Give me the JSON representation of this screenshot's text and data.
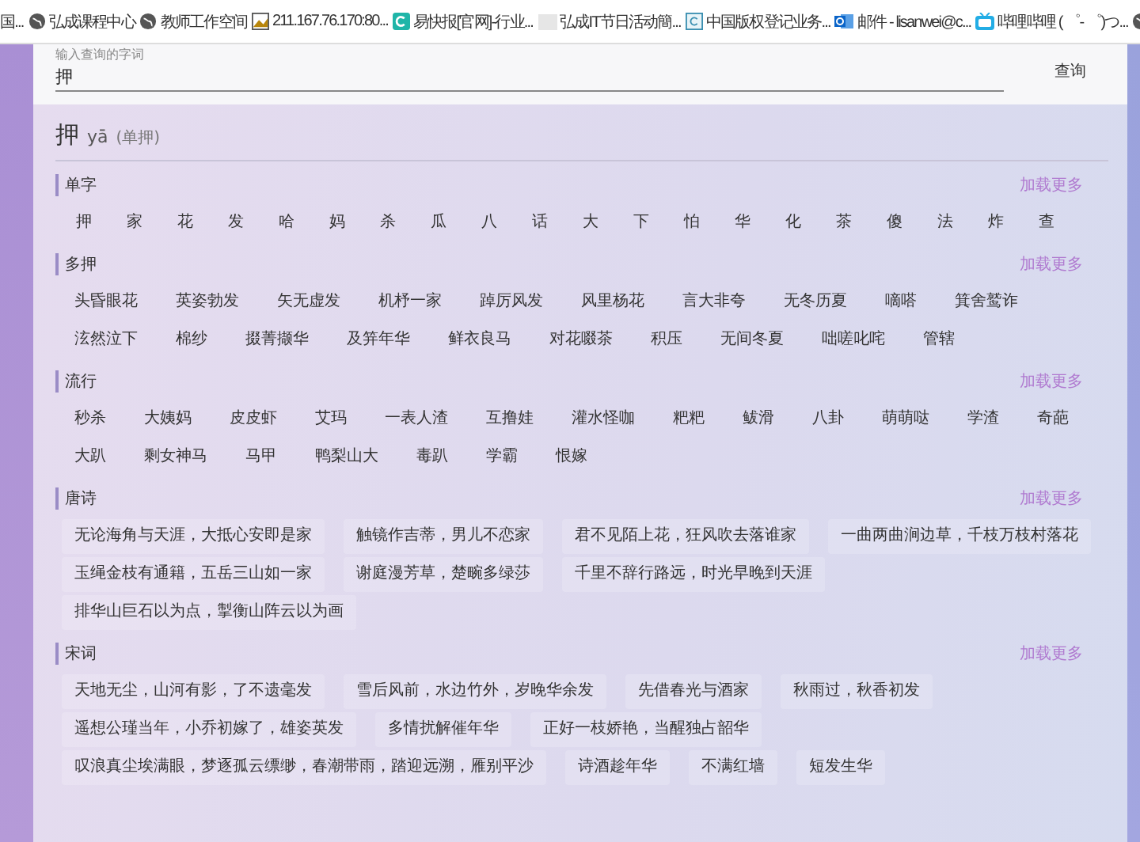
{
  "bookmarks": [
    "国...",
    "弘成课程中心",
    "教师工作空间",
    "211.167.76.170:80...",
    "易快报[官网]-行业...",
    "弘成IT节日活动簡...",
    "中国版权登记业务...",
    "邮件 - lisanwei@c...",
    "哔哩哔哩 ( ゜- ゜)つ..."
  ],
  "search": {
    "placeholder": "输入查询的字词",
    "value": "押",
    "button": "查询"
  },
  "heading": {
    "word": "押",
    "pinyin": "yā",
    "mode": "(单押)"
  },
  "sections": [
    {
      "title": "单字",
      "more": "加载更多",
      "kind": "char",
      "items": [
        "押",
        "家",
        "花",
        "发",
        "哈",
        "妈",
        "杀",
        "瓜",
        "八",
        "话",
        "大",
        "下",
        "怕",
        "华",
        "化",
        "茶",
        "傻",
        "法",
        "炸",
        "查"
      ]
    },
    {
      "title": "多押",
      "more": "加载更多",
      "kind": "word",
      "items": [
        "头昏眼花",
        "英姿勃发",
        "矢无虚发",
        "机杼一家",
        "踔厉风发",
        "风里杨花",
        "言大非夸",
        "无冬历夏",
        "嘀嗒",
        "箕舍鹫诈",
        "泫然泣下",
        "棉纱",
        "掇菁撷华",
        "及笄年华",
        "鲜衣良马",
        "对花啜茶",
        "积压",
        "无间冬夏",
        "咄嗟叱咤",
        "管辖"
      ]
    },
    {
      "title": "流行",
      "more": "加载更多",
      "kind": "word",
      "items": [
        "秒杀",
        "大姨妈",
        "皮皮虾",
        "艾玛",
        "一表人渣",
        "互撸娃",
        "灌水怪咖",
        "粑粑",
        "鲅滑",
        "八卦",
        "萌萌哒",
        "学渣",
        "奇葩",
        "大趴",
        "剩女神马",
        "马甲",
        "鸭梨山大",
        "毒趴",
        "学霸",
        "恨嫁"
      ]
    },
    {
      "title": "唐诗",
      "more": "加载更多",
      "kind": "verse",
      "items": [
        "无论海角与天涯，大抵心安即是家",
        "触镜作吉蒂，男儿不恋家",
        "君不见陌上花，狂风吹去落谁家",
        "一曲两曲涧边草，千枝万枝村落花",
        "玉绳金枝有通籍，五岳三山如一家",
        "谢庭漫芳草，楚畹多绿莎",
        "千里不辞行路远，时光早晚到天涯",
        "排华山巨石以为点，掣衡山阵云以为画"
      ]
    },
    {
      "title": "宋词",
      "more": "加载更多",
      "kind": "verse",
      "items": [
        "天地无尘，山河有影，了不遗毫发",
        "雪后风前，水边竹外，岁晚华余发",
        "先借春光与酒家",
        "秋雨过，秋香初发",
        "遥想公瑾当年，小乔初嫁了，雄姿英发",
        "多情扰解催年华",
        "正好一枝娇艳，当醒独占韶华",
        "叹浪真尘埃满眼，梦逐孤云缥缈，春潮带雨，踏迎远溯，雁别平沙",
        "诗酒趁年华",
        "不满红墙",
        "短发生华"
      ]
    }
  ]
}
